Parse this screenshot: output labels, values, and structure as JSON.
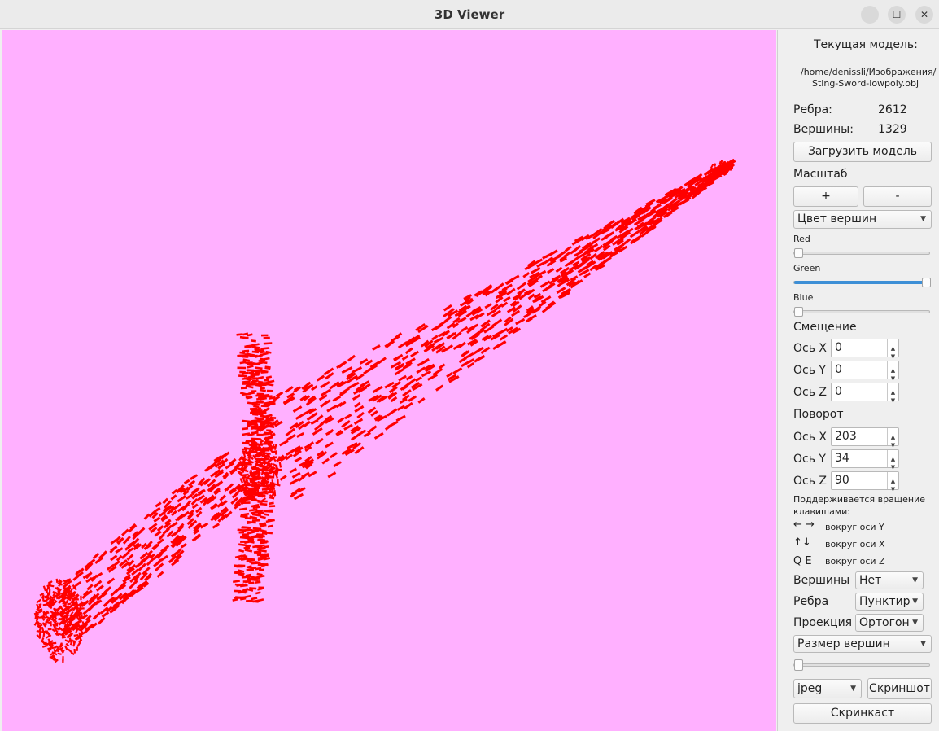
{
  "window": {
    "title": "3D Viewer"
  },
  "model": {
    "heading": "Текущая модель:",
    "path_line1": "/home/denissli/Изображения/",
    "path_line2": "Sting-Sword-lowpoly.obj",
    "edges_label": "Ребра:",
    "edges_value": "2612",
    "vertices_label": "Вершины:",
    "vertices_value": "1329",
    "load_button": "Загрузить модель"
  },
  "scale": {
    "label": "Масштаб",
    "plus": "+",
    "minus": "-"
  },
  "color": {
    "target_select": "Цвет вершин",
    "red_label": "Red",
    "green_label": "Green",
    "blue_label": "Blue",
    "red_level": 0.0,
    "green_level": 1.0,
    "blue_level": 0.0
  },
  "translate": {
    "label": "Смещение",
    "axis_x": "Ось X",
    "x_value": "0",
    "axis_y": "Ось Y",
    "y_value": "0",
    "axis_z": "Ось Z",
    "z_value": "0"
  },
  "rotate": {
    "label": "Поворот",
    "axis_x": "Ось X",
    "x_value": "203",
    "axis_y": "Ось Y",
    "y_value": "34",
    "axis_z": "Ось Z",
    "z_value": "90"
  },
  "hints": {
    "line1": "Поддерживается вращение",
    "line2": "клавишами:",
    "keys_lr": "← →",
    "desc_lr": "вокруг оси Y",
    "keys_ud": "↑↓",
    "desc_ud": "вокруг оси X",
    "keys_qe": "Q E",
    "desc_qe": "вокруг оси Z"
  },
  "display": {
    "vertices_label": "Вершины",
    "vertices_value": "Нет",
    "edges_label": "Ребра",
    "edges_value": "Пунктир",
    "projection_label": "Проекция",
    "projection_value": "Ортогон",
    "vertex_size_select": "Размер вершин",
    "vertex_size_level": 0.0
  },
  "export": {
    "format": "jpeg",
    "screenshot": "Скриншот",
    "screencast": "Скринкаст"
  },
  "colors": {
    "viewport_bg": "#ffb0ff",
    "model_color": "#ff0000",
    "slider_fill": "#3d8fd6"
  }
}
